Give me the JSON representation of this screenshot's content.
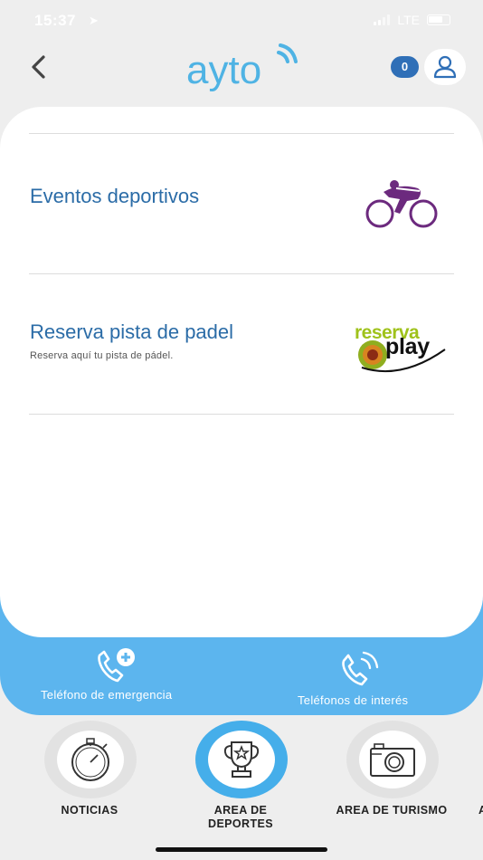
{
  "status_bar": {
    "time": "15:37",
    "carrier": "LTE"
  },
  "header": {
    "logo_text": "ayto",
    "notification_count": "0"
  },
  "services": [
    {
      "title": "Eventos deportivos",
      "subtitle": "",
      "icon": "cyclist-icon",
      "icon_color": "#6c2a7e"
    },
    {
      "title": "Reserva pista de padel",
      "subtitle": "Reserva aquí tu pista de pádel.",
      "icon": "reservaplay-logo",
      "logo_words": [
        "reserva",
        "play"
      ]
    }
  ],
  "contact_bar": {
    "emergency_label": "Teléfono de emergencia",
    "interest_label": "Teléfonos de interés"
  },
  "bottom_nav": [
    {
      "label": "NOTICIAS",
      "icon": "stopwatch-icon",
      "active": false
    },
    {
      "label": "AREA DE DEPORTES",
      "icon": "trophy-icon",
      "active": true
    },
    {
      "label": "AREA DE TURISMO",
      "icon": "camera-icon",
      "active": false
    }
  ],
  "bottom_nav_overflow_label": "A",
  "colors": {
    "accent_blue": "#5cb5ee",
    "title_blue": "#2b6ca7",
    "logo_blue": "#4fb3e4",
    "badge_blue": "#2f6fb7"
  }
}
